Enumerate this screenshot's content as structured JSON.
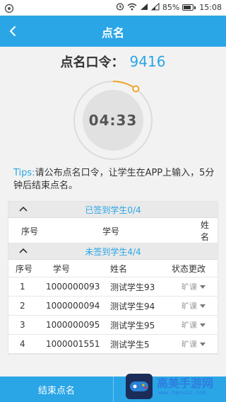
{
  "statusbar": {
    "battery": "85%",
    "time": "15:08",
    "network_label": "4G 2G"
  },
  "header": {
    "title": "点名"
  },
  "rollcall": {
    "label": "点名口令：",
    "code": "9416"
  },
  "timer": {
    "time": "04:33",
    "progress_fraction": 0.1
  },
  "tips": {
    "label": "Tips:",
    "text": "请公布点名口令，让学生在APP上输入，5分钟后结束点名。"
  },
  "signed": {
    "title": "已签到学生0/4",
    "columns": [
      "序号",
      "学号",
      "姓名"
    ],
    "rows": []
  },
  "unsigned": {
    "title": "未签到学生4/4",
    "columns": [
      "序号",
      "学号",
      "姓名",
      "状态更改"
    ],
    "rows": [
      {
        "index": "1",
        "student_id": "1000000093",
        "name": "测试学生93",
        "status": "旷课"
      },
      {
        "index": "2",
        "student_id": "1000000094",
        "name": "测试学生94",
        "status": "旷课"
      },
      {
        "index": "3",
        "student_id": "1000000095",
        "name": "测试学生95",
        "status": "旷课"
      },
      {
        "index": "4",
        "student_id": "1000001551",
        "name": "测试学生5",
        "status": "旷课"
      }
    ]
  },
  "footer": {
    "end_label": "结束点名"
  },
  "watermark": {
    "text": "高美手游网",
    "url": "www.haoxin.com"
  },
  "colors": {
    "accent": "#2aa6e6",
    "timer_arc": "#f0a429"
  }
}
